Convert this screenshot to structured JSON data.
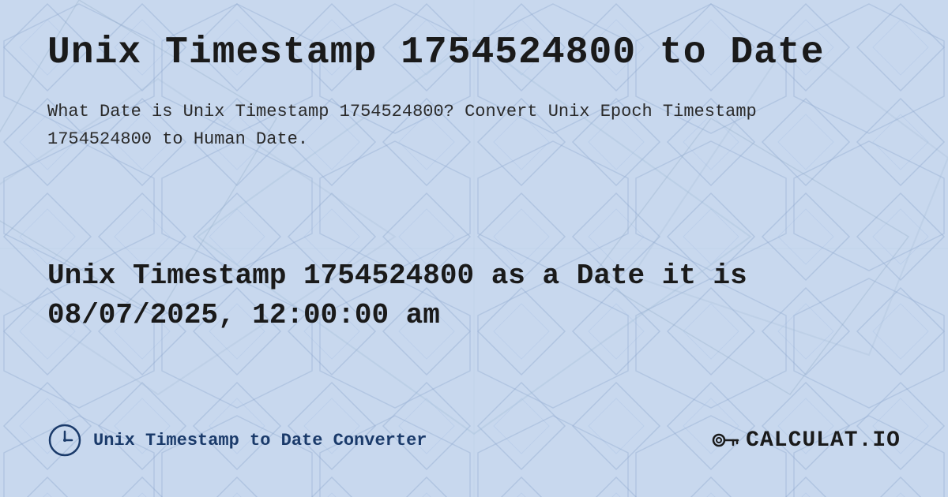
{
  "page": {
    "title": "Unix Timestamp 1754524800 to Date",
    "description": "What Date is Unix Timestamp 1754524800? Convert Unix Epoch Timestamp 1754524800 to Human Date.",
    "result_line1": "Unix Timestamp 1754524800 as a Date it is",
    "result_line2": "08/07/2025, 12:00:00 am",
    "footer_label": "Unix Timestamp to Date Converter",
    "logo_text": "CALCULAT.IO"
  },
  "background_color": "#c8d8f0",
  "accent_color": "#1a3a6a"
}
